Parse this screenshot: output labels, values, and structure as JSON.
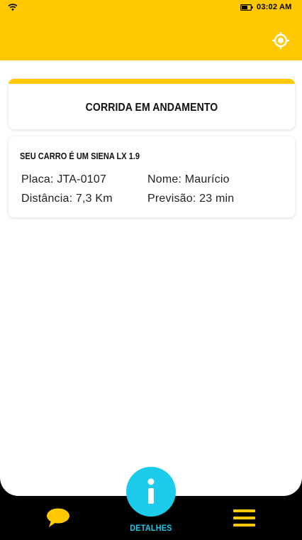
{
  "status_bar": {
    "time": "03:02 AM",
    "icons": [
      "wifi-icon",
      "battery-icon"
    ]
  },
  "header": {
    "locate_icon": "crosshair-locate-icon",
    "color": "#FFC800"
  },
  "ride_status": {
    "title": "CORRIDA EM ANDAMENTO"
  },
  "ride_details": {
    "car_title": "SEU CARRO É UM SIENA LX 1.9",
    "plate": "Placa: JTA-0107",
    "driver_name": "Nome: Maurício",
    "distance": "Distância: 7,3 Km",
    "eta": "Previsão: 23 min"
  },
  "bottom_nav": {
    "chat_icon": "chat-bubble-icon",
    "details_label": "DETALHES",
    "details_icon": "info-icon",
    "menu_icon": "hamburger-menu-icon",
    "accent_color": "#1CCBEA",
    "icon_color": "#FFC800"
  }
}
